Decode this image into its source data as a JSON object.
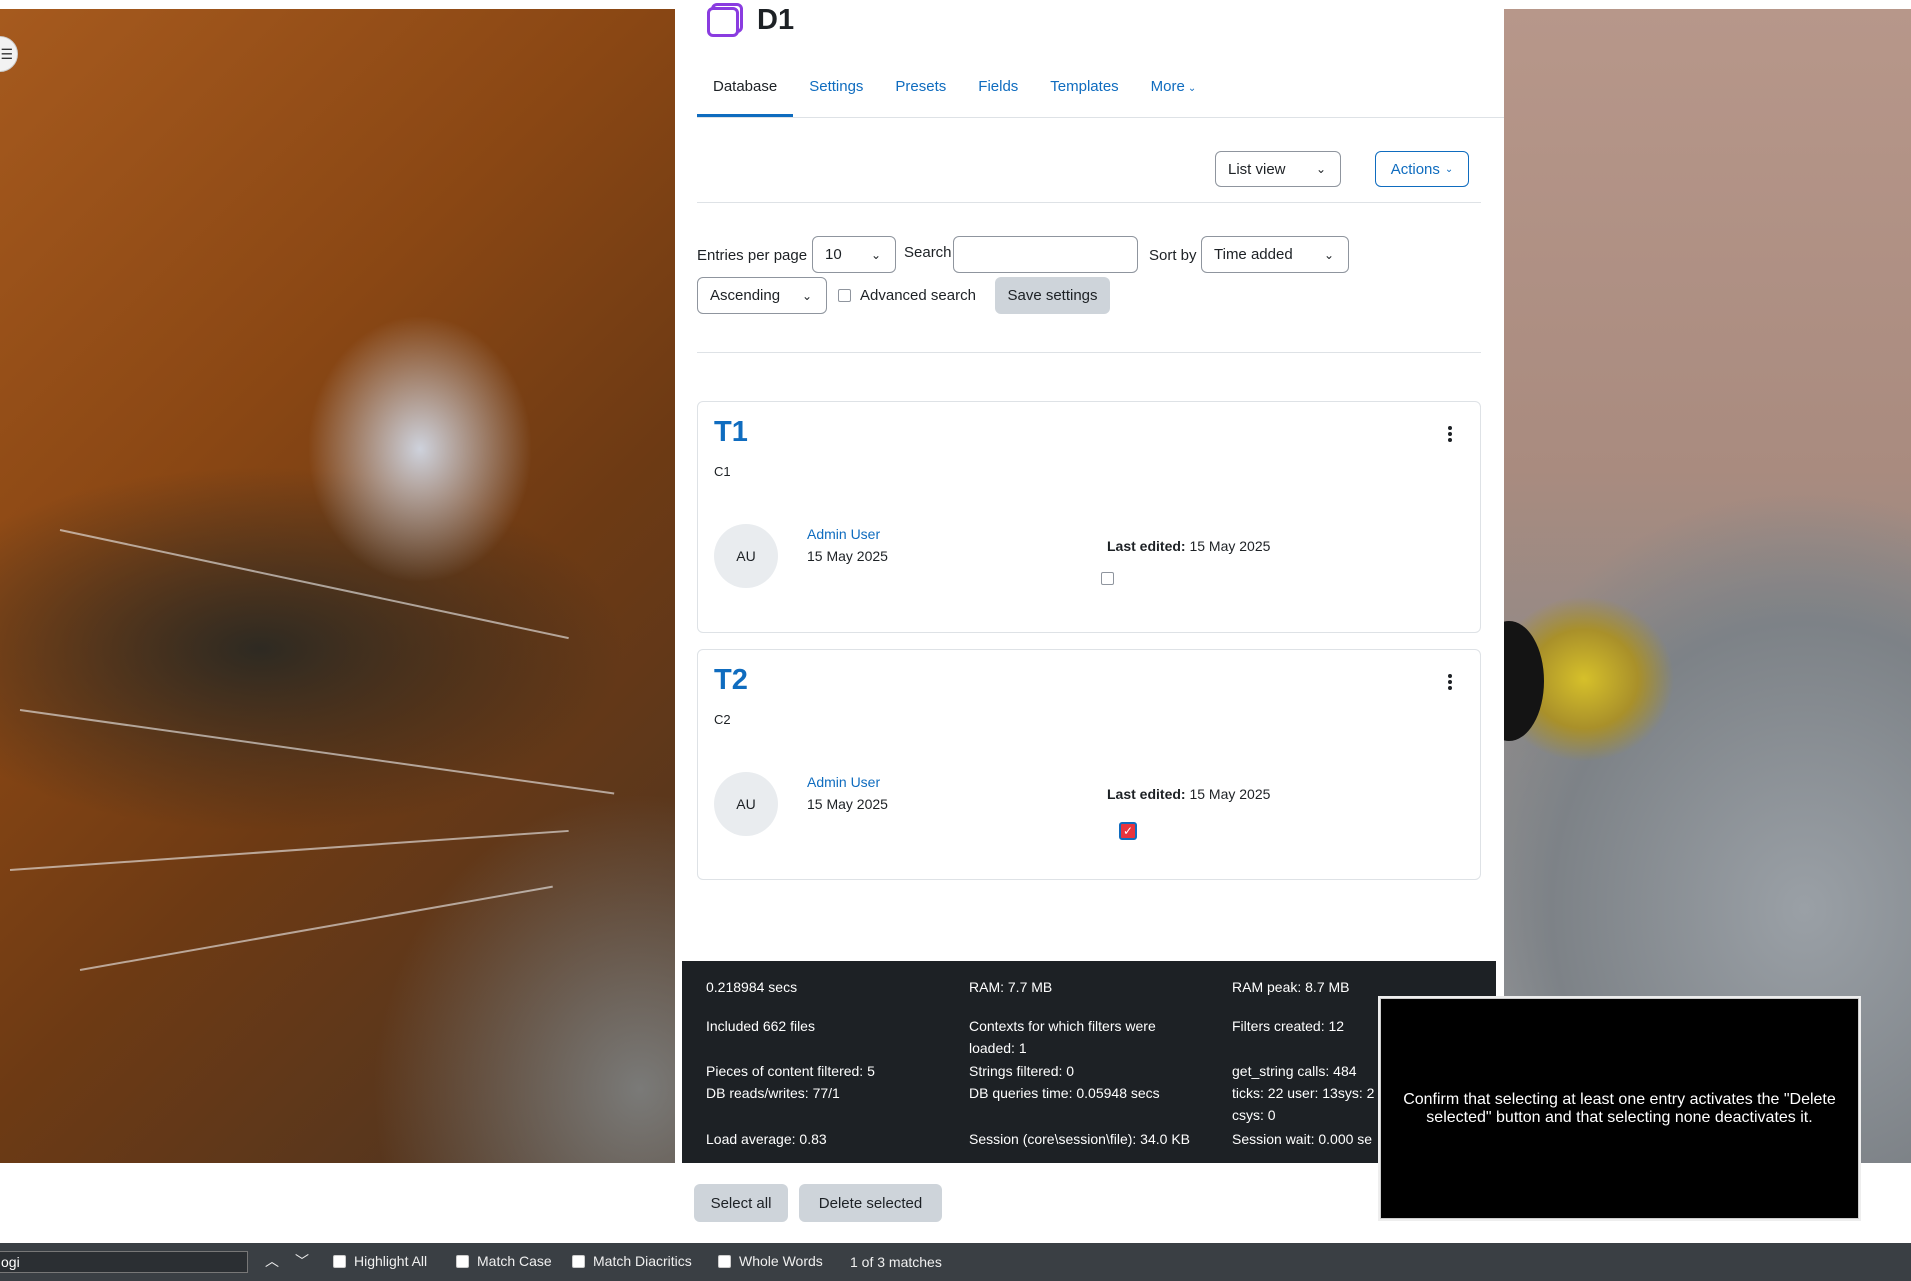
{
  "header": {
    "title": "D1"
  },
  "tabs": [
    {
      "label": "Database"
    },
    {
      "label": "Settings"
    },
    {
      "label": "Presets"
    },
    {
      "label": "Fields"
    },
    {
      "label": "Templates"
    },
    {
      "label": "More"
    }
  ],
  "toolbar": {
    "view_select": "List view",
    "actions_label": "Actions"
  },
  "filters": {
    "entries_label": "Entries per page",
    "entries_value": "10",
    "search_label": "Search",
    "search_value": "",
    "sort_label": "Sort by",
    "sort_value": "Time added",
    "order_value": "Ascending",
    "advanced_label": "Advanced search",
    "save_label": "Save settings"
  },
  "entries": [
    {
      "title": "T1",
      "content": "C1",
      "initials": "AU",
      "author": "Admin User",
      "date": "15 May 2025",
      "edited_label": "Last edited:",
      "edited_date": "15 May 2025",
      "selected": false
    },
    {
      "title": "T2",
      "content": "C2",
      "initials": "AU",
      "author": "Admin User",
      "date": "15 May 2025",
      "edited_label": "Last edited:",
      "edited_date": "15 May 2025",
      "selected": true
    }
  ],
  "perf": {
    "c1": [
      "0.218984 secs",
      "Included 662 files",
      "Pieces of content filtered: 5",
      "DB reads/writes: 77/1",
      "Load average: 0.83"
    ],
    "c2": [
      "RAM: 7.7 MB",
      "Contexts for which filters were",
      "loaded: 1",
      "Strings filtered: 0",
      "DB queries time: 0.05948 secs",
      "Session (core\\session\\file): 34.0 KB"
    ],
    "c3": [
      "RAM peak: 8.7 MB",
      "Filters created: 12",
      "get_string calls: 484",
      "ticks: 22 user: 13sys: 2",
      "csys: 0",
      "Session wait: 0.000 se"
    ]
  },
  "bottom": {
    "select_all": "Select all",
    "delete_selected": "Delete selected"
  },
  "overlay": {
    "text": "Confirm that selecting at least one entry activates the \"Delete selected\" button and that selecting none deactivates it."
  },
  "findbar": {
    "query": "ogi",
    "highlight_all": "Highlight All",
    "match_case": "Match Case",
    "match_diacritics": "Match Diacritics",
    "whole_words": "Whole Words",
    "count": "1 of 3 matches"
  },
  "colors": {
    "link": "#0f6cbf",
    "accent_icon": "#8a3ce0",
    "perf_bg": "#1d2125",
    "check_red": "#e8353e"
  }
}
